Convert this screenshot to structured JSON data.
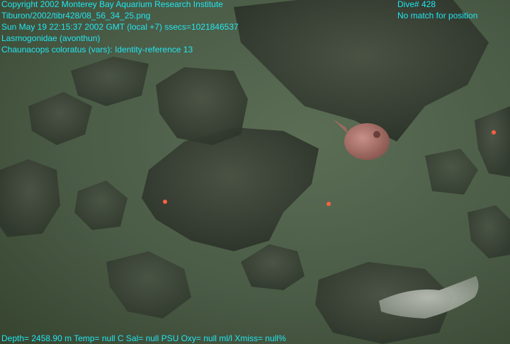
{
  "overlay": {
    "copyright": "Copyright 2002 Monterey Bay Aquarium Research Institute",
    "filename": "Tiburon/2002/tibr428/08_56_34_25.png",
    "datetime": "Sun May 19 22:15:37 2002 GMT (local +7)  ssecs=1021846537",
    "family": "Lasmogonidae (avonthun)",
    "species": "Chaunacops coloratus (vars): Identity-reference 13",
    "dive": "Dive# 428",
    "position_status": "No match for position",
    "sensors": "Depth= 2458.90 m  Temp= null C  Sal= null PSU  Oxy= null ml/l  Xmiss= null%"
  },
  "colors": {
    "overlay_text": "#22e6f0",
    "sediment": "#4f6049",
    "rock": "#3a4135",
    "laser": "#ff6040",
    "fish": "#b77d74"
  }
}
